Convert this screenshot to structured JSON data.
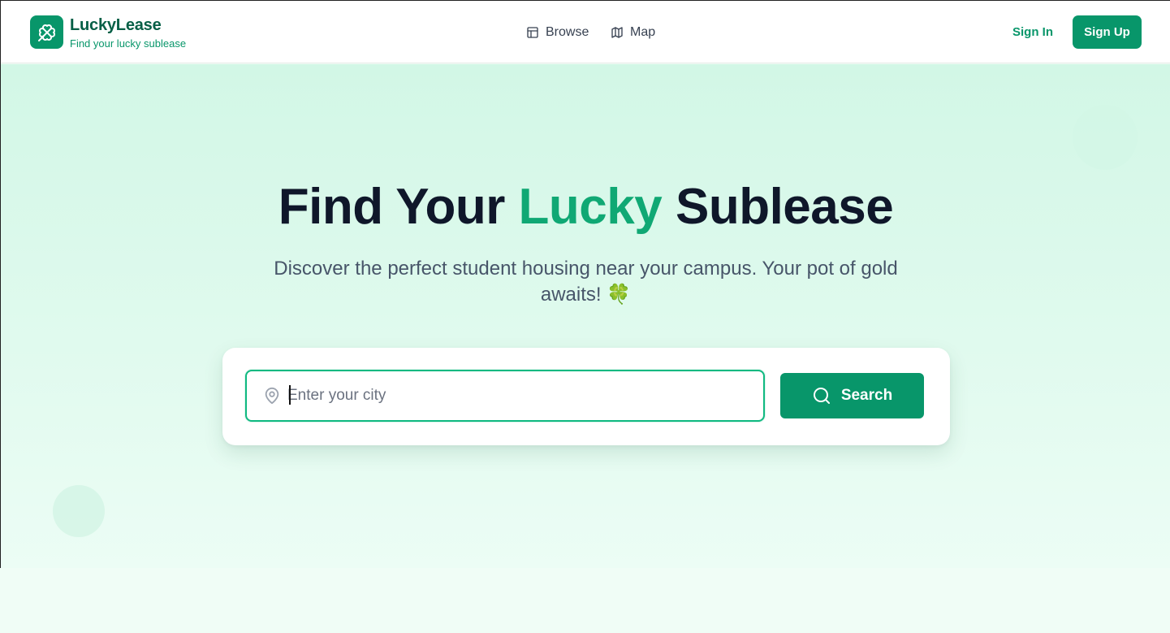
{
  "brand": {
    "name": "LuckyLease",
    "tagline": "Find your lucky sublease",
    "logo_icon": "clover-icon"
  },
  "nav": {
    "items": [
      {
        "label": "Browse",
        "icon": "layout-icon"
      },
      {
        "label": "Map",
        "icon": "map-icon"
      }
    ]
  },
  "auth": {
    "sign_in": "Sign In",
    "sign_up": "Sign Up"
  },
  "hero": {
    "title_part1": "Find Your ",
    "title_accent": "Lucky",
    "title_part2": " Sublease",
    "subtitle": "Discover the perfect student housing near your campus. Your pot of gold awaits! 🍀"
  },
  "search": {
    "placeholder": "Enter your city",
    "value": "",
    "button_label": "Search"
  },
  "colors": {
    "primary": "#08966a",
    "accent": "#10a874",
    "brand_dark": "#065f46",
    "hero_bg": "#d2f7e6"
  }
}
